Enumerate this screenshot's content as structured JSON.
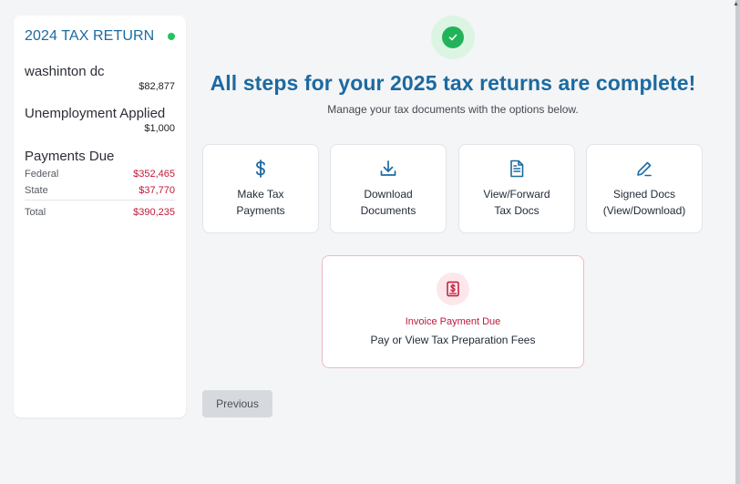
{
  "sidebar": {
    "title": "2024 TAX RETURN",
    "status_color": "#22c55e",
    "location_label": "washinton dc",
    "location_value": "$82,877",
    "unemployment_label": "Unemployment Applied",
    "unemployment_value": "$1,000",
    "payments_label": "Payments Due",
    "rows": [
      {
        "label": "Federal",
        "amount": "$352,465"
      },
      {
        "label": "State",
        "amount": "$37,770"
      }
    ],
    "total_label": "Total",
    "total_amount": "$390,235"
  },
  "main": {
    "headline": "All steps for your 2025 tax returns are complete!",
    "subline": "Manage your tax documents with the options below.",
    "cards": [
      {
        "icon": "dollar-icon",
        "line1": "Make Tax",
        "line2": "Payments"
      },
      {
        "icon": "download-icon",
        "line1": "Download",
        "line2": "Documents"
      },
      {
        "icon": "document-icon",
        "line1": "View/Forward",
        "line2": "Tax Docs"
      },
      {
        "icon": "pencil-icon",
        "line1": "Signed Docs",
        "line2": "(View/Download)"
      }
    ],
    "invoice": {
      "icon": "receipt-icon",
      "status": "Invoice Payment Due",
      "text": "Pay or View Tax Preparation Fees"
    },
    "previous_label": "Previous"
  },
  "colors": {
    "accent": "#1c6aa0",
    "success": "#22b35a",
    "danger": "#c0183a"
  }
}
